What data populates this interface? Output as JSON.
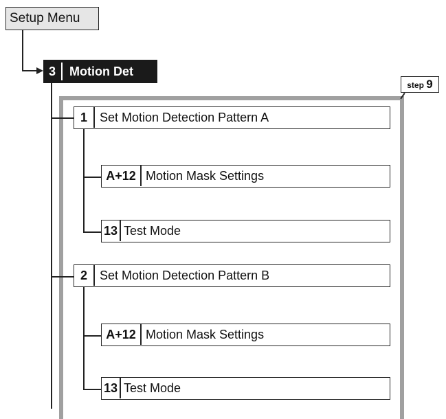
{
  "setup_menu": {
    "label": "Setup Menu"
  },
  "motion_det": {
    "number": "3",
    "label": "Motion Det"
  },
  "step_badge": {
    "prefix": "step",
    "number": "9"
  },
  "patterns": [
    {
      "number": "1",
      "label": "Set Motion Detection Pattern A",
      "items": [
        {
          "number": "A+12",
          "label": "Motion Mask Settings"
        },
        {
          "number": "13",
          "label": "Test Mode"
        }
      ]
    },
    {
      "number": "2",
      "label": "Set Motion Detection Pattern B",
      "items": [
        {
          "number": "A+12",
          "label": "Motion Mask Settings"
        },
        {
          "number": "13",
          "label": "Test Mode"
        }
      ]
    }
  ]
}
